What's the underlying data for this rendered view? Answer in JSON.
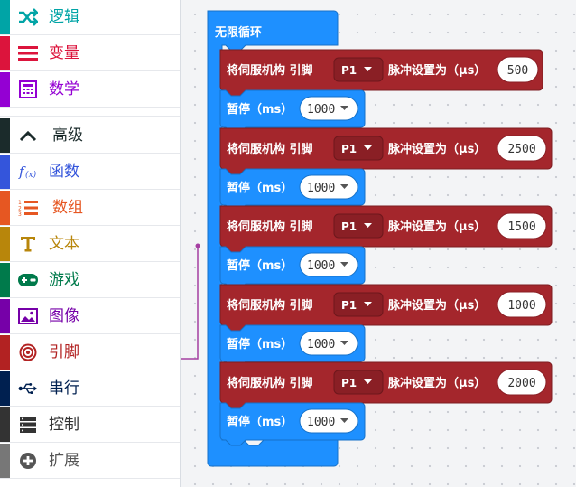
{
  "toolbox": {
    "categories": [
      {
        "label": "逻辑",
        "icon": "shuffle-icon",
        "color": "#00a4a6"
      },
      {
        "label": "变量",
        "icon": "variable-lines-icon",
        "color": "#dc143c"
      },
      {
        "label": "数学",
        "icon": "calculator-icon",
        "color": "#9400d3"
      },
      {
        "label": "高级",
        "icon": "chevron-up-icon",
        "color": "#1b2b2b"
      },
      {
        "label": "函数",
        "icon": "function-icon",
        "color": "#3455db"
      },
      {
        "label": "数组",
        "icon": "numbered-list-icon",
        "color": "#e65722"
      },
      {
        "label": "文本",
        "icon": "text-icon",
        "color": "#b8860b"
      },
      {
        "label": "游戏",
        "icon": "gamepad-icon",
        "color": "#007a4b"
      },
      {
        "label": "图像",
        "icon": "image-icon",
        "color": "#7600a8"
      },
      {
        "label": "引脚",
        "icon": "target-icon",
        "color": "#b22222"
      },
      {
        "label": "串行",
        "icon": "usb-icon",
        "color": "#002050"
      },
      {
        "label": "控制",
        "icon": "control-icon",
        "color": "#333333"
      },
      {
        "label": "扩展",
        "icon": "plus-circle-icon",
        "color": "#777777"
      }
    ]
  },
  "workspace": {
    "loop": {
      "label": "无限循环",
      "color": "#1e90ff"
    },
    "servo_color": "#a4262c",
    "pause_color": "#1e90ff",
    "blocks": [
      {
        "servo": {
          "prefix": "将伺服机构 引脚",
          "pin": "P1",
          "suffix": "脉冲设置为（µs）",
          "value": "500"
        },
        "pause": {
          "label": "暂停（ms）",
          "value": "1000"
        }
      },
      {
        "servo": {
          "prefix": "将伺服机构 引脚",
          "pin": "P1",
          "suffix": "脉冲设置为（µs）",
          "value": "2500"
        },
        "pause": {
          "label": "暂停（ms）",
          "value": "1000"
        }
      },
      {
        "servo": {
          "prefix": "将伺服机构 引脚",
          "pin": "P1",
          "suffix": "脉冲设置为（µs）",
          "value": "1500"
        },
        "pause": {
          "label": "暂停（ms）",
          "value": "1000"
        }
      },
      {
        "servo": {
          "prefix": "将伺服机构 引脚",
          "pin": "P1",
          "suffix": "脉冲设置为（µs）",
          "value": "1000"
        },
        "pause": {
          "label": "暂停（ms）",
          "value": "1000"
        }
      },
      {
        "servo": {
          "prefix": "将伺服机构 引脚",
          "pin": "P1",
          "suffix": "脉冲设置为（µs）",
          "value": "2000"
        },
        "pause": {
          "label": "暂停（ms）",
          "value": "1000"
        }
      }
    ]
  }
}
